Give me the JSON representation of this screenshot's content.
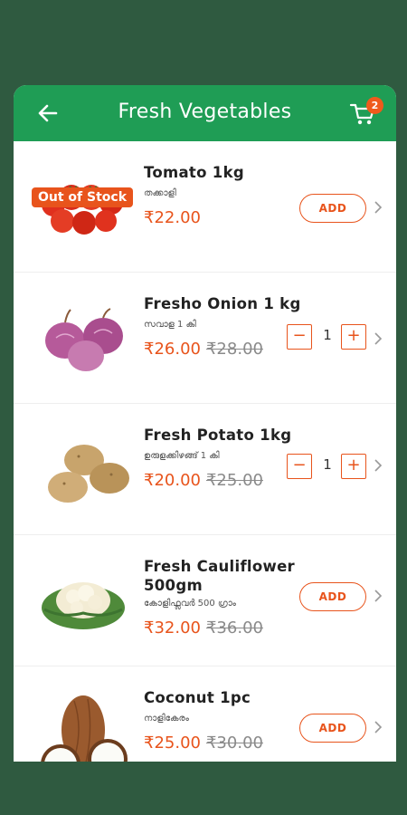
{
  "header": {
    "title": "Fresh Vegetables",
    "cart_count": "2",
    "brand_color": "#1f9d55",
    "accent_color": "#e8541c",
    "back_icon": "arrow-left-icon",
    "cart_icon": "shopping-cart-icon"
  },
  "products": [
    {
      "name": "Tomato 1kg",
      "local_name": "തക്കാളി",
      "price": "₹22.00",
      "mrp": "",
      "badge": "Out of Stock",
      "action": "ADD"
    },
    {
      "name": "Fresho Onion 1 kg",
      "local_name": "സവാള 1 കി",
      "price": "₹26.00",
      "mrp": "₹28.00",
      "quantity": "1"
    },
    {
      "name": "Fresh Potato 1kg",
      "local_name": "ഉരുളക്കിഴങ്ങ് 1 കി",
      "price": "₹20.00",
      "mrp": "₹25.00",
      "quantity": "1"
    },
    {
      "name": "Fresh Cauliflower 500gm",
      "local_name": "കോളിഫ്ലവർ 500 ഗ്രാം",
      "price": "₹32.00",
      "mrp": "₹36.00",
      "action": "ADD"
    },
    {
      "name": "Coconut 1pc",
      "local_name": "നാളികേരം",
      "price": "₹25.00",
      "mrp": "₹30.00",
      "action": "ADD"
    }
  ]
}
